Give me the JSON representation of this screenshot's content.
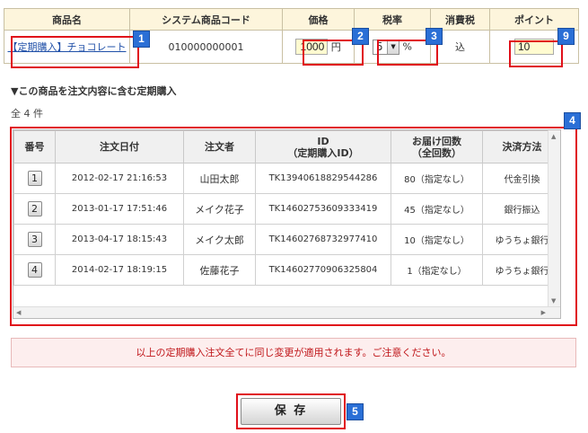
{
  "product_table": {
    "headers": [
      "商品名",
      "システム商品コード",
      "価格",
      "税率",
      "消費税",
      "ポイント"
    ],
    "product_name": "【定期購入】チョコレート",
    "system_code": "010000000001",
    "price": "1000",
    "price_unit": "円",
    "tax_rate": "5",
    "tax_unit": "%",
    "consumption_tax": "込",
    "points": "10"
  },
  "section_title": "▼この商品を注文内容に含む定期購入",
  "count_label": "全 4 件",
  "subscriptions": {
    "headers": {
      "no": "番号",
      "order_date": "注文日付",
      "orderer": "注文者",
      "id_line1": "ID",
      "id_line2": "（定期購入ID）",
      "delivery_line1": "お届け回数",
      "delivery_line2": "（全回数）",
      "payment": "決済方法"
    },
    "rows": [
      {
        "no": "1",
        "date": "2012-02-17 21:16:53",
        "name": "山田太郎",
        "id": "TK13940618829544286",
        "delivery": "80（指定なし）",
        "payment": "代金引換"
      },
      {
        "no": "2",
        "date": "2013-01-17 17:51:46",
        "name": "メイク花子",
        "id": "TK14602753609333419",
        "delivery": "45（指定なし）",
        "payment": "銀行振込"
      },
      {
        "no": "3",
        "date": "2013-04-17 18:15:43",
        "name": "メイク太郎",
        "id": "TK14602768732977410",
        "delivery": "10（指定なし）",
        "payment": "ゆうちょ銀行"
      },
      {
        "no": "4",
        "date": "2014-02-17 18:19:15",
        "name": "佐藤花子",
        "id": "TK14602770906325804",
        "delivery": "1（指定なし）",
        "payment": "ゆうちょ銀行"
      }
    ]
  },
  "notice": "以上の定期購入注文全てに同じ変更が適用されます。ご注意ください。",
  "save_label": "保 存",
  "badges": {
    "b1": "1",
    "b2": "2",
    "b3": "3",
    "b4": "4",
    "b5": "5",
    "b9": "9"
  },
  "colors": {
    "accent_red": "#e0101a",
    "badge_blue": "#2a6fd6",
    "header_bg": "#fdf5dc"
  }
}
